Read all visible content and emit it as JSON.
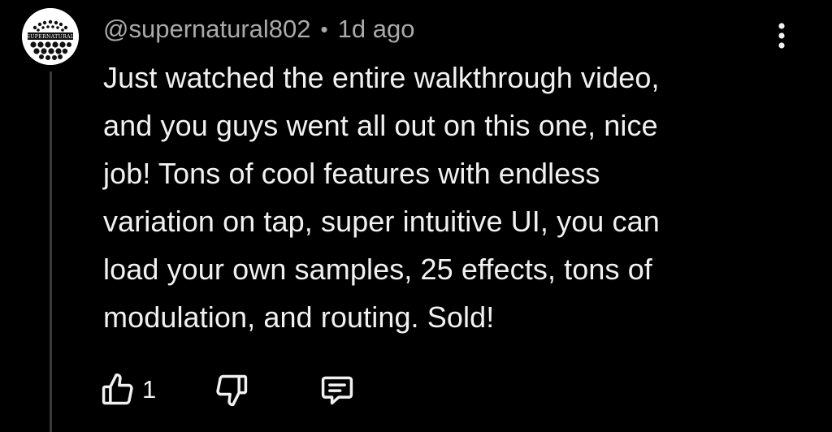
{
  "comment": {
    "author": "@supernatural802",
    "separator": "•",
    "time_ago": "1d ago",
    "avatar_text": "SUPERNATURAL",
    "text": "Just watched the entire walkthrough video,\nand you guys went all out on this one, nice\njob! Tons of cool features with endless\nvariation on tap, super intuitive UI, you can\nload your own samples, 25 effects, tons of\nmodulation, and routing. Sold!",
    "like_count": "1"
  },
  "icons": {
    "like": "thumbs-up-icon",
    "dislike": "thumbs-down-icon",
    "reply": "reply-comment-icon",
    "menu": "more-vertical-icon"
  },
  "colors": {
    "background": "#000000",
    "text": "#f1f1f1",
    "meta": "#aaaaaa",
    "thread_line": "#3a3a3a"
  }
}
